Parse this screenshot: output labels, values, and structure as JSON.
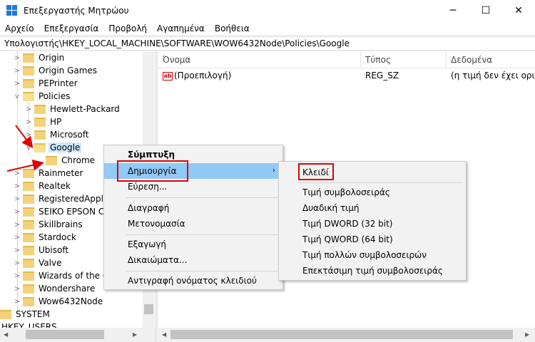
{
  "window": {
    "title": "Επεξεργαστής Μητρώου",
    "minimize_glyph": "─",
    "maximize_glyph": "☐",
    "close_glyph": "✕"
  },
  "menu": [
    "Αρχείο",
    "Επεξεργασία",
    "Προβολή",
    "Αγαπημένα",
    "Βοήθεια"
  ],
  "address": "Υπολογιστής\\HKEY_LOCAL_MACHINE\\SOFTWARE\\WOW6432Node\\Policies\\Google",
  "tree": [
    {
      "label": "Origin",
      "expand": ">",
      "indent": 1
    },
    {
      "label": "Origin Games",
      "expand": ">",
      "indent": 1
    },
    {
      "label": "PEPrinter",
      "expand": ">",
      "indent": 1
    },
    {
      "label": "Policies",
      "expand": "v",
      "indent": 1
    },
    {
      "label": "Hewlett-Packard",
      "expand": ">",
      "indent": 2
    },
    {
      "label": "HP",
      "expand": ">",
      "indent": 2
    },
    {
      "label": "Microsoft",
      "expand": ">",
      "indent": 2
    },
    {
      "label": "Google",
      "expand": "v",
      "indent": 2,
      "selected": true
    },
    {
      "label": "Chrome",
      "expand": "",
      "indent": 3
    },
    {
      "label": "Rainmeter",
      "expand": ">",
      "indent": 1
    },
    {
      "label": "Realtek",
      "expand": ">",
      "indent": 1
    },
    {
      "label": "RegisteredApplic",
      "expand": ">",
      "indent": 1
    },
    {
      "label": "SEIKO EPSON Co",
      "expand": ">",
      "indent": 1
    },
    {
      "label": "Skillbrains",
      "expand": ">",
      "indent": 1
    },
    {
      "label": "Stardock",
      "expand": ">",
      "indent": 1
    },
    {
      "label": "Ubisoft",
      "expand": ">",
      "indent": 1
    },
    {
      "label": "Valve",
      "expand": ">",
      "indent": 1
    },
    {
      "label": "Wizards of the Co",
      "expand": ">",
      "indent": 1
    },
    {
      "label": "Wondershare",
      "expand": ">",
      "indent": 1
    },
    {
      "label": "Wow6432Node",
      "expand": ">",
      "indent": 1
    },
    {
      "label": "SYSTEM",
      "expand": ">",
      "indent": 0
    },
    {
      "label": "HKEY_USERS",
      "expand": ">",
      "indent": -1
    }
  ],
  "list": {
    "headers": [
      "Όνομα",
      "Τύπος",
      "Δεδομένα"
    ],
    "rows": [
      {
        "icon": "ab",
        "name": "(Προεπιλογή)",
        "type": "REG_SZ",
        "data": "(η τιμή δεν έχει οριστεί)"
      }
    ]
  },
  "context_menu": {
    "items": [
      "Σύμπτυξη",
      "Δημιουργία",
      "Εύρεση...",
      "Διαγραφή",
      "Μετονομασία",
      "Εξαγωγή",
      "Δικαιώματα...",
      "Αντιγραφή ονόματος κλειδιού"
    ],
    "submenu_arrow": "›"
  },
  "submenu": {
    "items": [
      "Κλειδί",
      "Τιμή συμβολοσειράς",
      "Δυαδική τιμή",
      "Τιμή DWORD (32 bit)",
      "Τιμή QWORD (64 bit)",
      "Τιμή πολλών συμβολοσειρών",
      "Επεκτάσιμη τιμή συμβολοσειράς"
    ]
  },
  "colors": {
    "highlight": "#91c9f7",
    "selection": "#cce8ff",
    "annotation_red": "#e00000",
    "folder": "#f3d27a"
  }
}
